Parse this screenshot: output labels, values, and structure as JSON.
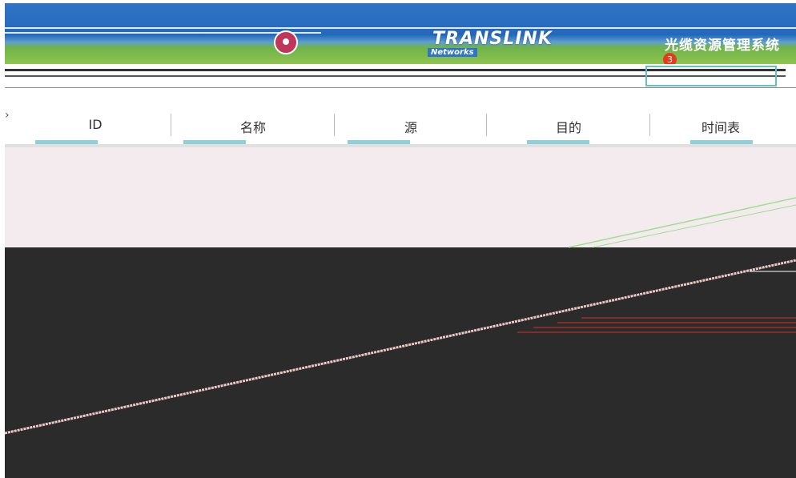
{
  "header": {
    "brand": "TRANSLINK",
    "sub_brand": "Networks",
    "system_title": "光缆资源管理系统",
    "notice_count": "3",
    "colors": {
      "primary": "#2f74c5",
      "accent": "#8dc44f",
      "badge": "#e53a1c"
    }
  },
  "filters": {
    "columns": [
      {
        "label": "ID"
      },
      {
        "label": "名称"
      },
      {
        "label": "源"
      },
      {
        "label": "目的"
      },
      {
        "label": "时间表"
      }
    ]
  },
  "result": {
    "empty_text": ""
  },
  "map": {
    "background": "#2b2b2b"
  }
}
